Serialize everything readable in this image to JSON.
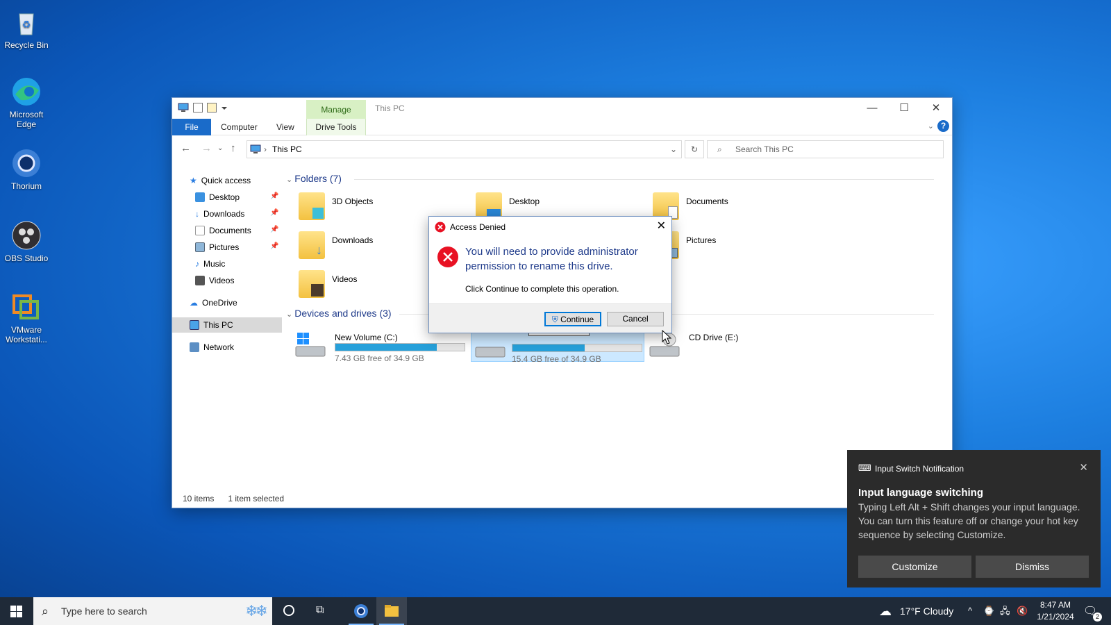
{
  "desktop": {
    "icons": [
      {
        "label": "Recycle Bin"
      },
      {
        "label": "Microsoft Edge"
      },
      {
        "label": "Thorium"
      },
      {
        "label": "OBS Studio"
      },
      {
        "label": "VMware Workstati..."
      }
    ]
  },
  "explorer": {
    "title": "This PC",
    "manage_tab": "Manage",
    "ribbon_tabs": {
      "file": "File",
      "computer": "Computer",
      "view": "View",
      "drive_tools": "Drive Tools"
    },
    "address": {
      "path": "This PC"
    },
    "search": {
      "placeholder": "Search This PC"
    },
    "sidebar": {
      "quick_access": "Quick access",
      "desktop": "Desktop",
      "downloads": "Downloads",
      "documents": "Documents",
      "pictures": "Pictures",
      "music": "Music",
      "videos": "Videos",
      "onedrive": "OneDrive",
      "this_pc": "This PC",
      "network": "Network"
    },
    "folders_header": "Folders (7)",
    "folders": {
      "objects3d": "3D Objects",
      "desktop": "Desktop",
      "documents": "Documents",
      "downloads": "Downloads",
      "pictures": "Pictures",
      "videos": "Videos"
    },
    "drives_header": "Devices and drives (3)",
    "drives": {
      "c": {
        "name": "New Volume (C:)",
        "free": "7.43 GB free of 34.9 GB",
        "used_fraction": 0.787
      },
      "d": {
        "free": "15.4 GB free of 34.9 GB",
        "used_fraction": 0.559
      },
      "e": {
        "name": "CD Drive (E:)"
      }
    },
    "status": {
      "items": "10 items",
      "selected": "1 item selected"
    }
  },
  "dialog": {
    "title": "Access Denied",
    "message": "You will need to provide administrator permission to rename this drive.",
    "sub": "Click Continue to complete this operation.",
    "continue": "Continue",
    "cancel": "Cancel"
  },
  "toast": {
    "header": "Input Switch Notification",
    "title": "Input language switching",
    "body": "Typing Left Alt + Shift changes your input language. You can turn this feature off or change your hot key sequence by selecting Customize.",
    "customize": "Customize",
    "dismiss": "Dismiss"
  },
  "taskbar": {
    "search_placeholder": "Type here to search",
    "weather": "17°F  Cloudy",
    "time": "8:47 AM",
    "date": "1/21/2024",
    "notifications_count": "2"
  }
}
